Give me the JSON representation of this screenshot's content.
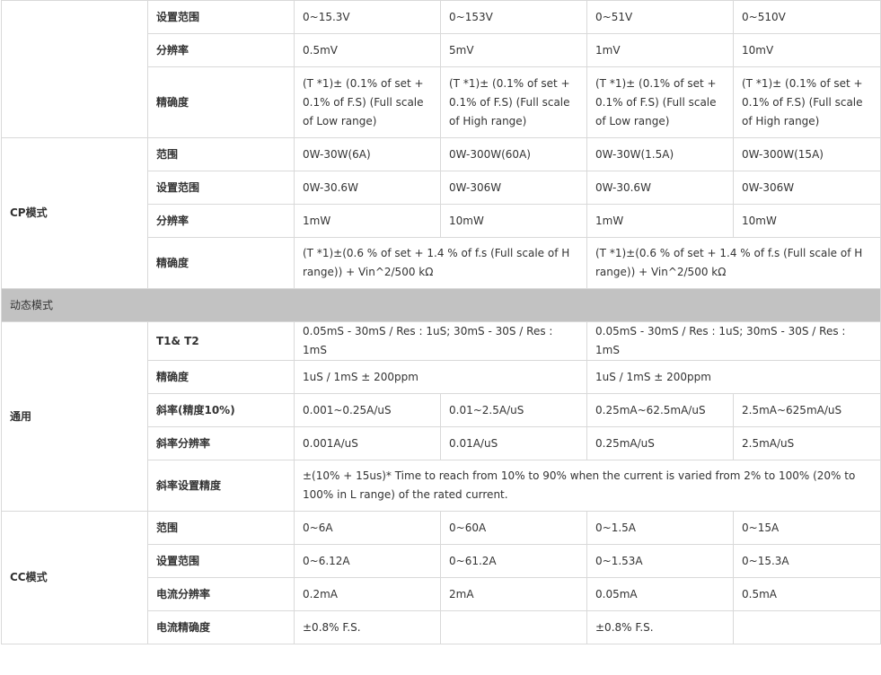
{
  "cv_tail": {
    "set_range": {
      "label": "设置范围",
      "v": [
        "0~15.3V",
        "0~153V",
        "0~51V",
        "0~510V"
      ]
    },
    "resolution": {
      "label": "分辨率",
      "v": [
        "0.5mV",
        "5mV",
        "1mV",
        "10mV"
      ]
    },
    "accuracy": {
      "label": "精确度",
      "v": [
        "(T *1)± (0.1% of set + 0.1% of F.S) (Full scale of Low range)",
        "(T *1)± (0.1% of set + 0.1% of F.S) (Full scale of High range)",
        "(T *1)± (0.1% of set + 0.1% of F.S) (Full scale of Low range)",
        "(T *1)± (0.1% of set + 0.1% of F.S) (Full scale of High range)"
      ]
    }
  },
  "cp": {
    "group": "CP模式",
    "range": {
      "label": "范围",
      "v": [
        "0W-30W(6A)",
        "0W-300W(60A)",
        "0W-30W(1.5A)",
        "0W-300W(15A)"
      ]
    },
    "set_range": {
      "label": "设置范围",
      "v": [
        "0W-30.6W",
        "0W-306W",
        "0W-30.6W",
        "0W-306W"
      ]
    },
    "resolution": {
      "label": "分辨率",
      "v": [
        "1mW",
        "10mW",
        "1mW",
        "10mW"
      ]
    },
    "accuracy": {
      "label": "精确度",
      "v": [
        "(T *1)±(0.6 % of set + 1.4 % of f.s (Full scale of H range)) + Vin^2/500 kΩ",
        "(T *1)±(0.6 % of set + 1.4 % of f.s (Full scale of H range)) + Vin^2/500 kΩ"
      ]
    }
  },
  "dynamic": {
    "section": "动态模式",
    "group": "通用",
    "t1t2": {
      "label": "T1& T2",
      "v": [
        "0.05mS - 30mS / Res : 1uS; 30mS - 30S / Res : 1mS",
        "0.05mS - 30mS / Res : 1uS; 30mS - 30S / Res : 1mS"
      ]
    },
    "accuracy": {
      "label": "精确度",
      "v": [
        "1uS / 1mS ± 200ppm",
        "1uS / 1mS ± 200ppm"
      ]
    },
    "slew": {
      "label": "斜率(精度10%)",
      "v": [
        "0.001~0.25A/uS",
        "0.01~2.5A/uS",
        "0.25mA~62.5mA/uS",
        "2.5mA~625mA/uS"
      ]
    },
    "slew_res": {
      "label": "斜率分辨率",
      "v": [
        "0.001A/uS",
        "0.01A/uS",
        "0.25mA/uS",
        "2.5mA/uS"
      ]
    },
    "slew_acc": {
      "label": "斜率设置精度",
      "v": "±(10% + 15us)* Time to reach from 10% to 90% when the current is varied from 2% to 100% (20% to 100% in L range) of the rated current."
    }
  },
  "cc": {
    "group": "CC模式",
    "range": {
      "label": "范围",
      "v": [
        "0~6A",
        "0~60A",
        "0~1.5A",
        "0~15A"
      ]
    },
    "set_range": {
      "label": "设置范围",
      "v": [
        "0~6.12A",
        "0~61.2A",
        "0~1.53A",
        "0~15.3A"
      ]
    },
    "resolution": {
      "label": "电流分辨率",
      "v": [
        "0.2mA",
        "2mA",
        "0.05mA",
        "0.5mA"
      ]
    },
    "accuracy": {
      "label": "电流精确度",
      "v": [
        "±0.8% F.S.",
        "",
        "±0.8% F.S.",
        ""
      ]
    }
  }
}
